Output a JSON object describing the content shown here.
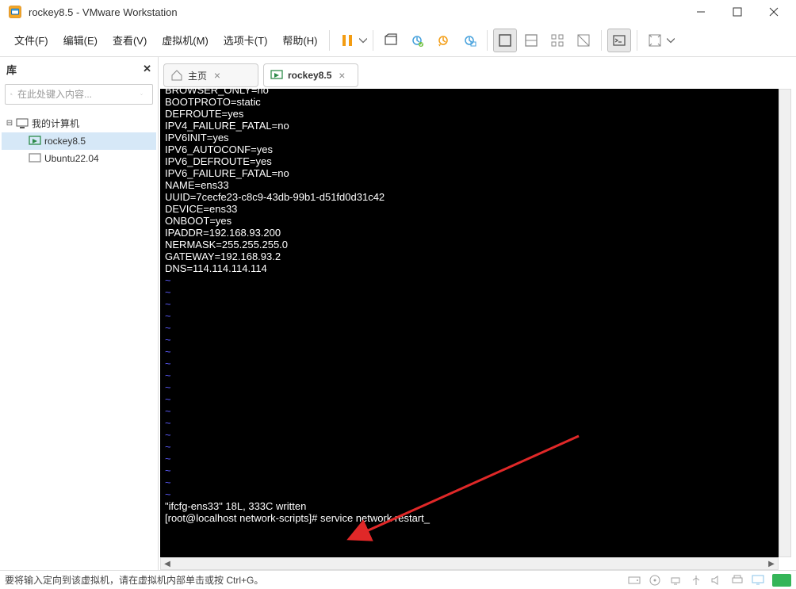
{
  "window": {
    "title": "rockey8.5 - VMware Workstation"
  },
  "menu": {
    "file": "文件(F)",
    "edit": "编辑(E)",
    "view": "查看(V)",
    "vm": "虚拟机(M)",
    "tabs": "选项卡(T)",
    "help": "帮助(H)"
  },
  "sidebar": {
    "header": "库",
    "search_placeholder": "在此处键入内容...",
    "tree": {
      "root": "我的计算机",
      "items": [
        {
          "label": "rockey8.5",
          "selected": true,
          "color": "#2e8b4a"
        },
        {
          "label": "Ubuntu22.04",
          "selected": false,
          "color": "#888"
        }
      ]
    }
  },
  "tabs": [
    {
      "label": "主页",
      "icon": "home",
      "active": false
    },
    {
      "label": "rockey8.5",
      "icon": "vm",
      "active": true
    }
  ],
  "terminal": {
    "lines": [
      "BOOTPROTO=static",
      "DEFROUTE=yes",
      "IPV4_FAILURE_FATAL=no",
      "IPV6INIT=yes",
      "IPV6_AUTOCONF=yes",
      "IPV6_DEFROUTE=yes",
      "IPV6_FAILURE_FATAL=no",
      "NAME=ens33",
      "UUID=7cecfe23-c8c9-43db-99b1-d51fd0d31c42",
      "DEVICE=ens33",
      "ONBOOT=yes",
      "IPADDR=192.168.93.200",
      "NERMASK=255.255.255.0",
      "GATEWAY=192.168.93.2",
      "DNS=114.114.114.114"
    ],
    "bottom_status": "\"ifcfg-ens33\" 18L, 333C written",
    "prompt": "[root@localhost network-scripts]# service network restart_",
    "cut_top_line": "BROWSER_ONLY=no"
  },
  "status": {
    "text": "要将输入定向到该虚拟机，请在虚拟机内部单击或按 Ctrl+G。"
  },
  "icons": {
    "search": "search-icon",
    "close": "close-icon",
    "dropdown": "chevron-down-icon"
  }
}
